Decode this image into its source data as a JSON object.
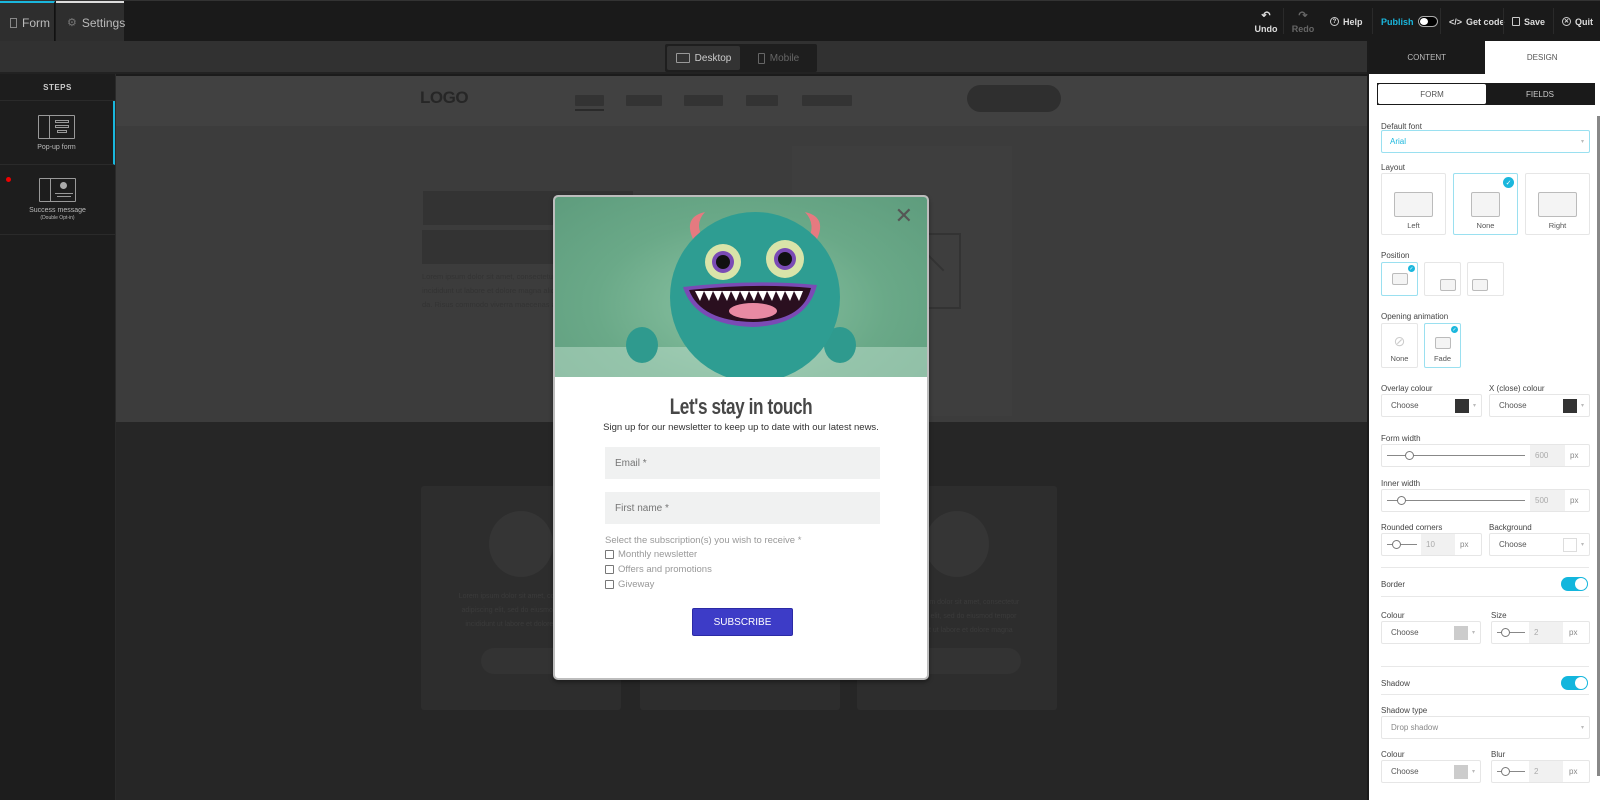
{
  "topbar": {
    "tabs": [
      {
        "label": "Form",
        "icon": "form-icon"
      },
      {
        "label": "Settings",
        "icon": "gear-icon"
      }
    ],
    "undo": "Undo",
    "redo": "Redo",
    "help": "Help",
    "publish": "Publish",
    "publish_on": false,
    "get_code": "Get code",
    "save": "Save",
    "quit": "Quit"
  },
  "device_toggle": {
    "desktop": "Desktop",
    "mobile": "Mobile",
    "active": "Desktop"
  },
  "steps": {
    "title": "STEPS",
    "items": [
      {
        "label": "Pop-up form",
        "active": true
      },
      {
        "label": "Success message",
        "sublabel": "(Double Opt-in)",
        "warning": true
      }
    ]
  },
  "preview": {
    "logo": "LOGO",
    "lorem_hero": [
      "Lorem ipsum dolor sit amet, consectetur adipiscing elit, sed do eiusmod tempor",
      "incididunt ut labore et dolore magna aliqua. Quis ipsum suspendisse ultrices gravi-",
      "da. Risus commodo viverra maecenas accumsan lacus vel facilisis."
    ],
    "lorem_card": [
      "Lorem ipsum dolor sit amet, consectetur",
      "adipiscing elit, sed do eiusmod tempor",
      "incididunt ut labore et dolore magna"
    ]
  },
  "popup": {
    "title": "Let's stay in touch",
    "subtitle": "Sign up for our newsletter to keep up to date with our latest news.",
    "email_placeholder": "Email *",
    "firstname_placeholder": "First name *",
    "subscription_label": "Select the subscription(s) you wish to receive *",
    "options": [
      "Monthly newsletter",
      "Offers and promotions",
      "Giveway"
    ],
    "button": "SUBSCRIBE",
    "button_color": "#3d3cc7",
    "close": "✕"
  },
  "panel": {
    "tabs": [
      "CONTENT",
      "DESIGN"
    ],
    "active_tab": "DESIGN",
    "subtabs": [
      "FORM",
      "FIELDS"
    ],
    "active_subtab": "FORM",
    "default_font_label": "Default font",
    "default_font": "Arial",
    "layout_label": "Layout",
    "layout_options": [
      "Left",
      "None",
      "Right"
    ],
    "layout_selected": "None",
    "position_label": "Position",
    "position_selected": 0,
    "animation_label": "Opening animation",
    "animation_options": [
      "None",
      "Fade"
    ],
    "animation_selected": "Fade",
    "overlay_colour_label": "Overlay colour",
    "overlay_choose": "Choose",
    "overlay_color": "#333333",
    "close_colour_label": "X (close) colour",
    "close_choose": "Choose",
    "close_color": "#333333",
    "form_width_label": "Form width",
    "form_width": "600",
    "form_width_unit": "px",
    "inner_width_label": "Inner width",
    "inner_width": "500",
    "inner_width_unit": "px",
    "rounded_label": "Rounded corners",
    "rounded": "10",
    "rounded_unit": "px",
    "background_label": "Background",
    "background_choose": "Choose",
    "background_color": "#ffffff",
    "border_label": "Border",
    "border_on": true,
    "border_colour_label": "Colour",
    "border_choose": "Choose",
    "border_color": "#cccccc",
    "border_size_label": "Size",
    "border_size": "2",
    "border_size_unit": "px",
    "shadow_label": "Shadow",
    "shadow_on": true,
    "shadow_type_label": "Shadow type",
    "shadow_type": "Drop shadow",
    "shadow_colour_label": "Colour",
    "shadow_choose": "Choose",
    "shadow_color": "#cccccc",
    "blur_label": "Blur",
    "blur": "2",
    "blur_unit": "px",
    "accent": "#1ab7dd"
  }
}
